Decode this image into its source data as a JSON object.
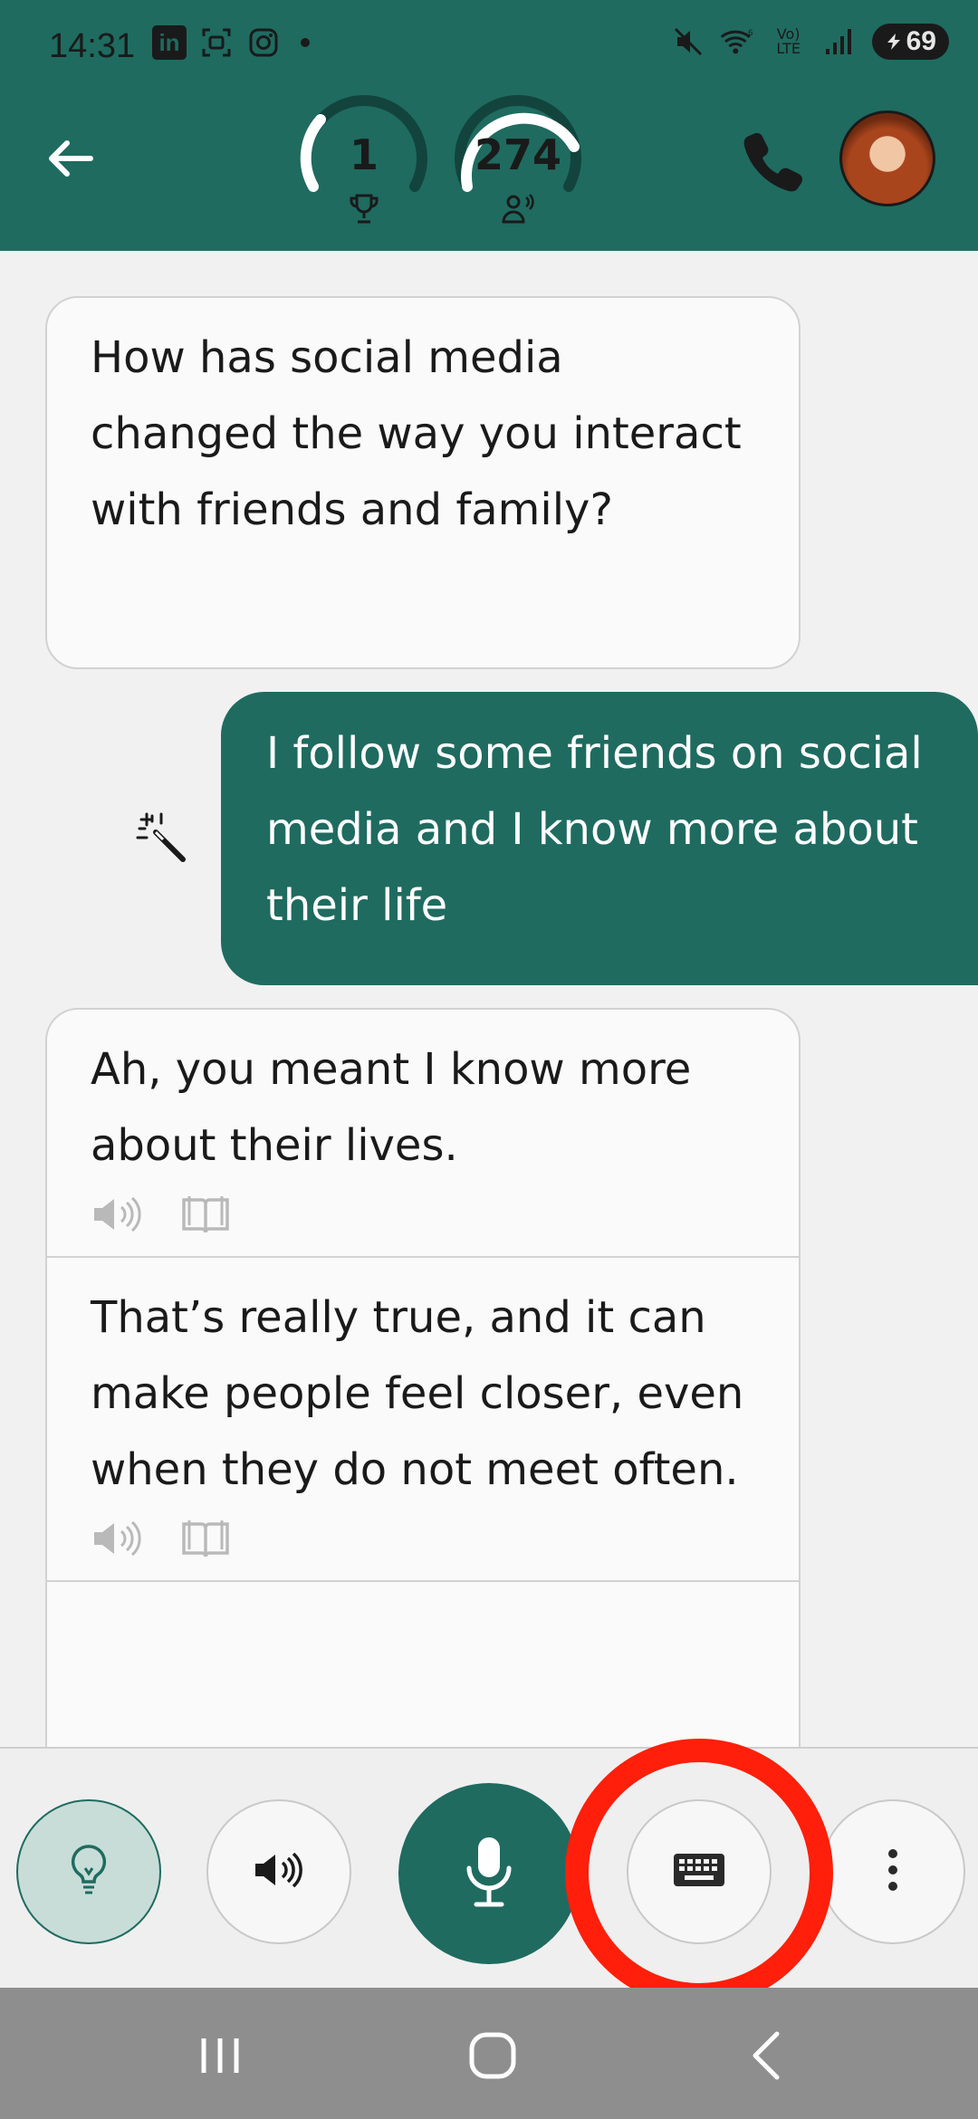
{
  "status_bar": {
    "time": "14:31",
    "battery": "69",
    "network": "Vo) LTE"
  },
  "header": {
    "trophy_count": "1",
    "listener_count": "274",
    "accent_color": "#1f6b60"
  },
  "messages": {
    "question": "How has social media changed the way you interact with friends and family?",
    "user_reply": "I follow some friends on social media and I know more about their life",
    "correction": "Ah, you meant I know more about their lives.",
    "response": "That’s really true, and it can make people feel closer, even when they do not meet often."
  },
  "icons": {
    "back": "arrow-left-icon",
    "trophy": "trophy-icon",
    "listeners": "people-icon",
    "call": "phone-icon",
    "wand": "magic-wand-icon",
    "speaker": "speaker-icon",
    "book": "book-icon",
    "hint": "lightbulb-icon",
    "mic": "microphone-icon",
    "keyboard": "keyboard-icon",
    "more": "more-vertical-icon"
  }
}
